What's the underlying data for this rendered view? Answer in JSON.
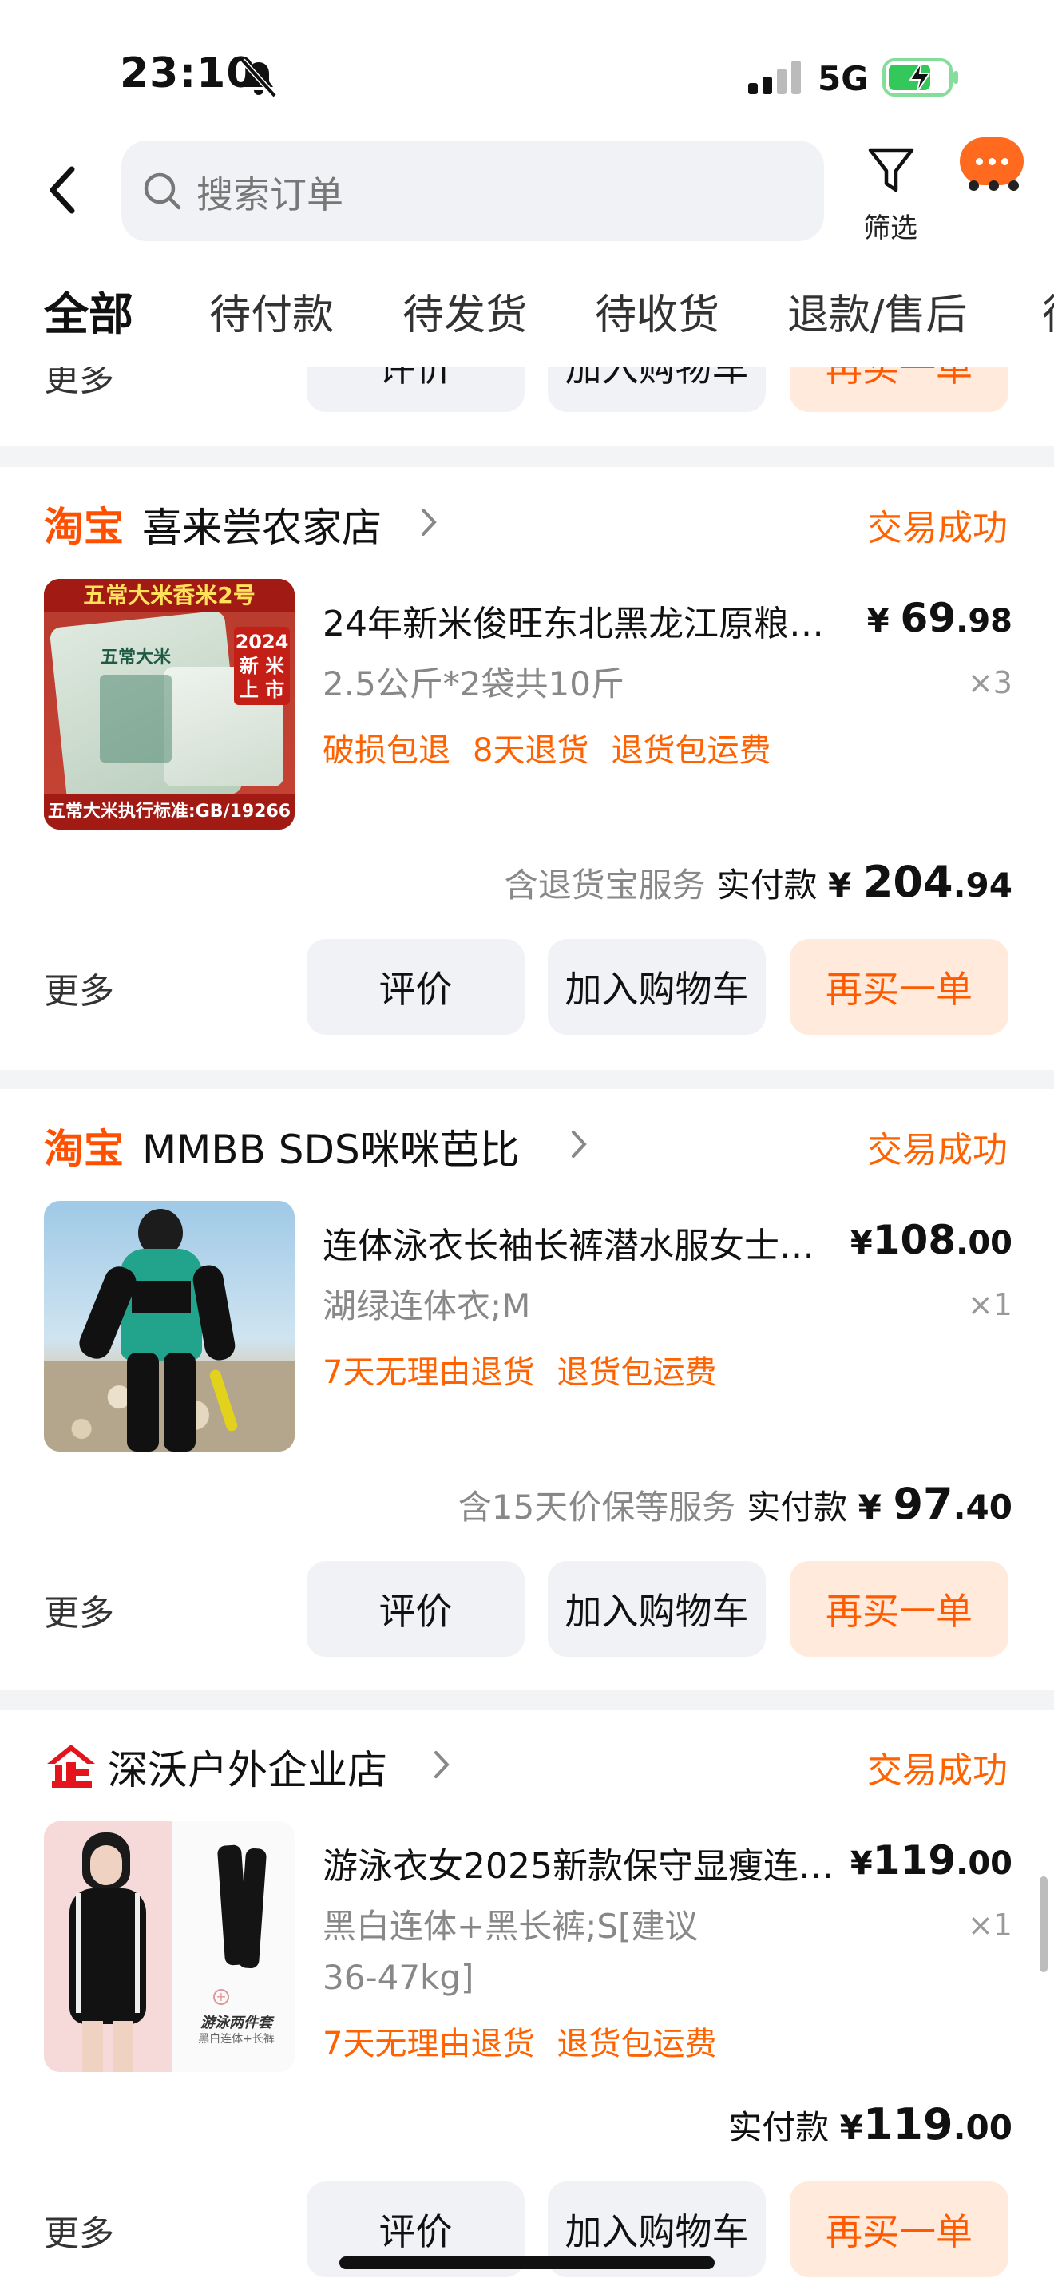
{
  "status_bar": {
    "time": "23:10",
    "network": "5G"
  },
  "header": {
    "search_placeholder": "搜索订单",
    "filter_label": "筛选"
  },
  "tabs": [
    "全部",
    "待付款",
    "待发货",
    "待收货",
    "退款/售后",
    "待"
  ],
  "prev_card": {
    "more": "更多",
    "buttons": [
      "评价",
      "加入购物车",
      "再买一单"
    ]
  },
  "orders": [
    {
      "logo": "淘宝",
      "shop": "喜来尝农家店",
      "status": "交易成功",
      "title": "24年新米俊旺东北黑龙江原粮…",
      "price_prefix": "¥",
      "price_int": "69",
      "price_dec": ".98",
      "spec": "2.5公斤*2袋共10斤",
      "qty": "×3",
      "tags": [
        "破损包退",
        "8天退货",
        "退货包运费"
      ],
      "service": "含退货宝服务",
      "paid_label": "实付款",
      "paid_prefix": "¥",
      "paid_int": "204",
      "paid_dec": ".94",
      "more": "更多",
      "buttons": [
        "评价",
        "加入购物车",
        "再买一单"
      ],
      "img_text": {
        "top": "五常大米香米2号",
        "badge1": "2024",
        "badge2": "新 米",
        "badge3": "上 市",
        "bag": "五常大米",
        "bottom": "五常大米执行标准:GB/19266"
      }
    },
    {
      "logo": "淘宝",
      "shop": "MMBB SDS咪咪芭比",
      "status": "交易成功",
      "title": "连体泳衣长袖长裤潜水服女士…",
      "price_prefix": "¥",
      "price_int": "108",
      "price_dec": ".00",
      "spec": "湖绿连体衣;M",
      "qty": "×1",
      "tags": [
        "7天无理由退货",
        "退货包运费"
      ],
      "service": "含15天价保等服务",
      "paid_label": "实付款",
      "paid_prefix": "¥",
      "paid_int": "97",
      "paid_dec": ".40",
      "more": "更多",
      "buttons": [
        "评价",
        "加入购物车",
        "再买一单"
      ]
    },
    {
      "logo": "企",
      "shop": "深沃户外企业店",
      "status": "交易成功",
      "title": "游泳衣女2025新款保守显瘦连…",
      "price_prefix": "¥",
      "price_int": "119",
      "price_dec": ".00",
      "spec_line1": "黑白连体+黑长裤;S[建议",
      "spec_line2": "36-47kg]",
      "qty": "×1",
      "tags": [
        "7天无理由退货",
        "退货包运费"
      ],
      "service": "",
      "paid_label": "实付款",
      "paid_prefix": "¥",
      "paid_int": "119",
      "paid_dec": ".00",
      "more": "更多",
      "buttons": [
        "评价",
        "加入购物车",
        "再买一单"
      ],
      "img_text": {
        "caption1": "游泳两件套",
        "caption2": "黑白连体+长裤"
      }
    }
  ],
  "colors": {
    "accent": "#ff5000",
    "status": "#ff6200",
    "bg": "#f3f4f6",
    "button_bg": "#f1f2f5",
    "rebuy_bg": "#ffeadb"
  }
}
